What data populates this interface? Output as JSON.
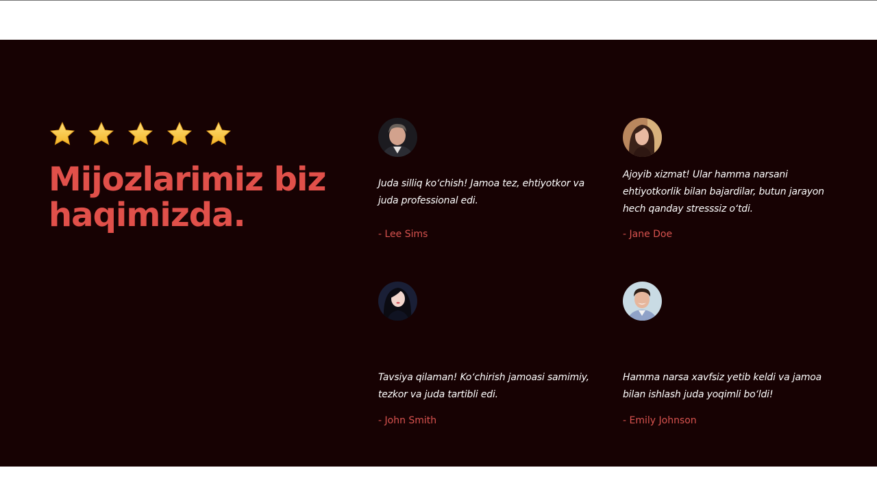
{
  "section": {
    "rating_stars": 5,
    "heading": "Mijozlarimiz biz haqimizda.",
    "colors": {
      "background": "#170203",
      "accent": "#e1504a",
      "star": "#f7c53a"
    }
  },
  "testimonials": [
    {
      "quote": "Juda silliq ko‘chish! Jamoa tez, ehtiyotkor va juda professional edi.",
      "author": "- Lee Sims",
      "avatar_icon": "avatar-man-gray-hair"
    },
    {
      "quote": "Ajoyib xizmat! Ular hamma narsani ehtiyotkorlik bilan bajardilar, butun jarayon hech qanday stresssiz o‘tdi.",
      "author": "- Jane Doe",
      "avatar_icon": "avatar-woman-dark-hair"
    },
    {
      "quote": "Tavsiya qilaman! Ko‘chirish jamoasi samimiy, tezkor va juda tartibli edi.",
      "author": "- John Smith",
      "avatar_icon": "avatar-woman-black-hair"
    },
    {
      "quote": "Hamma narsa xavfsiz yetib keldi va jamoa bilan ishlash juda yoqimli bo‘ldi!",
      "author": "- Emily Johnson",
      "avatar_icon": "avatar-man-smiling"
    }
  ]
}
